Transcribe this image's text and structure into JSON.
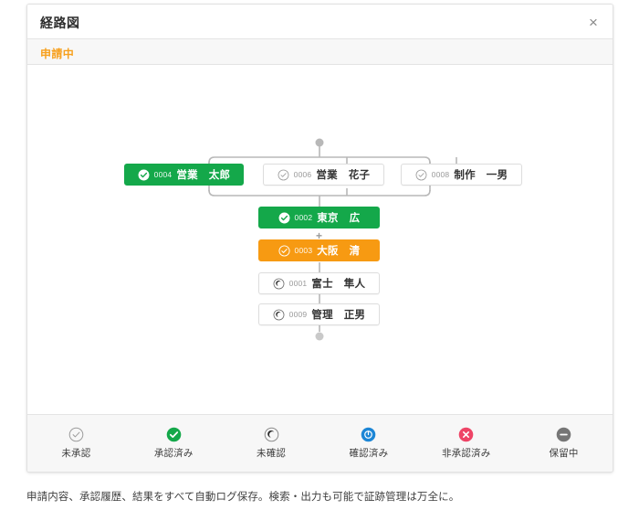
{
  "window": {
    "title": "経路図",
    "close_label": "×",
    "close_icon": "close-icon"
  },
  "status": {
    "label": "申請中",
    "color": "#f7a01d"
  },
  "colors": {
    "approved_green": "#14a84a",
    "pending_orange": "#f79a12",
    "confirmed_blue": "#1c86d6",
    "rejected_red": "#ee4466",
    "hold_gray": "#767676",
    "unapproved_gray": "#9b9b9b",
    "wire_gray": "#b8b8b8",
    "card_border": "#e2e2e2",
    "footer_bg": "#f7f7f7"
  },
  "diagram": {
    "top_connector_dot": "start-node-dot",
    "bottom_connector_dot": "end-node-dot",
    "plus_separator": "+",
    "rows": [
      {
        "row_name": "parallel-approver-row",
        "nodes": [
          {
            "id": "0004",
            "name": "営業　太郎",
            "state": "approved",
            "style": "green",
            "icon": "check-circle-filled-icon"
          },
          {
            "id": "0006",
            "name": "営業　花子",
            "state": "unapproved",
            "style": "white",
            "icon": "check-circle-outline-icon"
          },
          {
            "id": "0008",
            "name": "制作　一男",
            "state": "unapproved",
            "style": "white",
            "icon": "check-circle-outline-icon"
          }
        ]
      },
      {
        "row_name": "approver-row-2",
        "nodes": [
          {
            "id": "0002",
            "name": "東京　広",
            "state": "approved",
            "style": "green",
            "icon": "check-circle-filled-icon"
          }
        ]
      },
      {
        "row_name": "approver-row-3",
        "nodes": [
          {
            "id": "0003",
            "name": "大阪　清",
            "state": "pending",
            "style": "orange",
            "icon": "check-circle-filled-icon"
          }
        ]
      },
      {
        "row_name": "confirmer-row-1",
        "nodes": [
          {
            "id": "0001",
            "name": "富士　隼人",
            "state": "unconfirmed",
            "style": "white",
            "icon": "moon-circle-icon"
          }
        ]
      },
      {
        "row_name": "confirmer-row-2",
        "nodes": [
          {
            "id": "0009",
            "name": "管理　正男",
            "state": "unconfirmed",
            "style": "white",
            "icon": "moon-circle-icon"
          }
        ]
      }
    ]
  },
  "legend": {
    "items": [
      {
        "label": "未承認",
        "icon": "check-circle-outline-icon",
        "color": "#9b9b9b"
      },
      {
        "label": "承認済み",
        "icon": "check-circle-filled-icon",
        "color": "#14a84a"
      },
      {
        "label": "未確認",
        "icon": "moon-circle-icon",
        "color": "#767676"
      },
      {
        "label": "確認済み",
        "icon": "clock-circle-icon",
        "color": "#1c86d6"
      },
      {
        "label": "非承認済み",
        "icon": "x-circle-icon",
        "color": "#ee4466"
      },
      {
        "label": "保留中",
        "icon": "minus-circle-icon",
        "color": "#767676"
      }
    ]
  },
  "caption": {
    "text": "申請内容、承認履歴、結果をすべて自動ログ保存。検索・出力も可能で証跡管理は万全に。"
  }
}
